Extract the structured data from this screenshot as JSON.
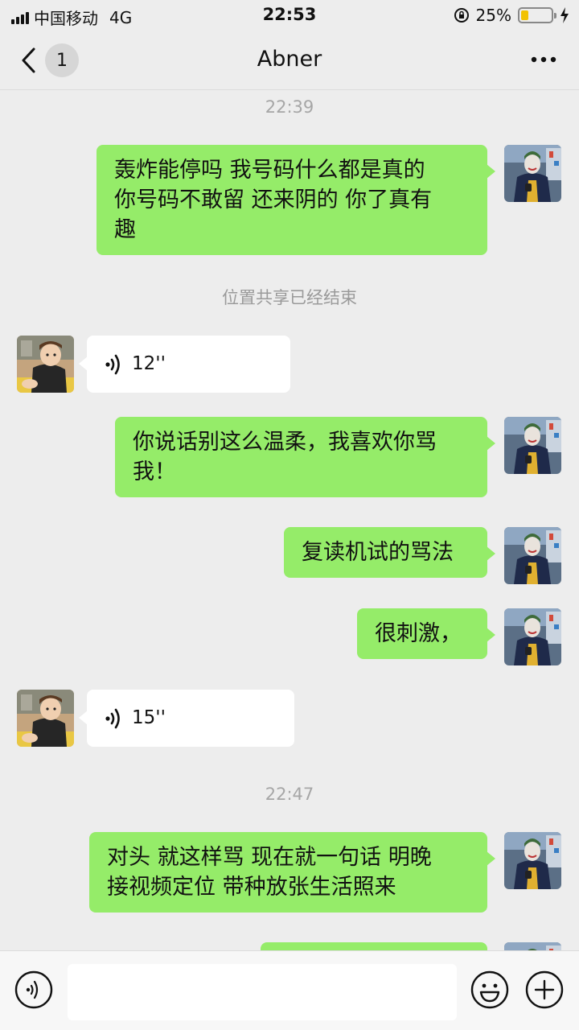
{
  "status_bar": {
    "carrier": "中国移动",
    "network": "4G",
    "time": "22:53",
    "battery_text": "25%",
    "battery_level": 0.25
  },
  "nav": {
    "unread_count": "1",
    "title": "Abner",
    "back_icon": "chevron-left-icon",
    "more_icon": "more-icon"
  },
  "chat": {
    "time_1": "22:39",
    "msg_1": "轰炸能停吗 我号码什么都是真的\n你号码不敢留 还来阴的  你了真有\n趣",
    "system_1": "位置共享已经结束",
    "voice_1": "12''",
    "msg_2": "你说话别这么温柔，我喜欢你骂\n我！",
    "msg_3": "复读机试的骂法",
    "msg_4": "很刺激，",
    "voice_2": "15''",
    "time_2": "22:47",
    "msg_5": "对头 就这样骂  现在就一句话 明晚\n接视频定位  带种放张生活照来"
  },
  "colors": {
    "sent_bubble": "#95ec69",
    "recv_bubble": "#ffffff",
    "background": "#ededed"
  },
  "input_bar": {
    "voice_icon": "voice-mode-icon",
    "emoji_icon": "emoji-icon",
    "plus_icon": "plus-icon"
  }
}
